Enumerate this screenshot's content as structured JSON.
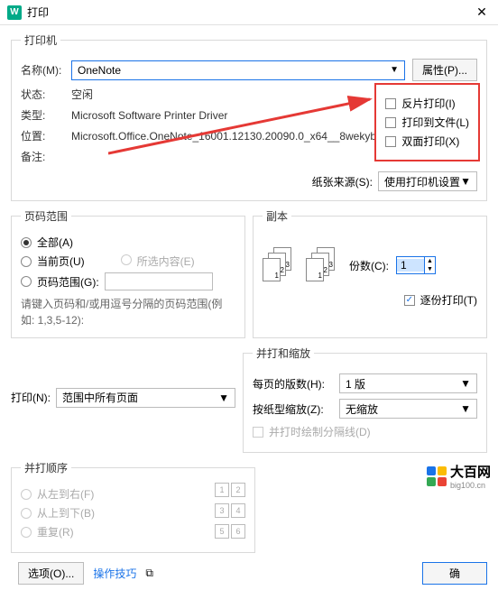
{
  "title": "打印",
  "printer_group": "打印机",
  "name_label": "名称(M):",
  "name_value": "OneNote",
  "properties_btn": "属性(P)...",
  "status_label": "状态:",
  "status_value": "空闲",
  "type_label": "类型:",
  "type_value": "Microsoft Software Printer Driver",
  "where_label": "位置:",
  "where_value": "Microsoft.Office.OneNote_16001.12130.20090.0_x64__8wekyb",
  "comment_label": "备注:",
  "opt_mirror": "反片打印(I)",
  "opt_tofile": "打印到文件(L)",
  "opt_duplex": "双面打印(X)",
  "paper_src_label": "纸张来源(S):",
  "paper_src_value": "使用打印机设置",
  "page_range_group": "页码范围",
  "range_all": "全部(A)",
  "range_current": "当前页(U)",
  "range_selection": "所选内容(E)",
  "range_pages": "页码范围(G):",
  "range_hint": "请键入页码和/或用逗号分隔的页码范围(例如: 1,3,5-12):",
  "print_what_label": "打印(N):",
  "print_what_value": "范围中所有页面",
  "copies_group": "副本",
  "copies_label": "份数(C):",
  "copies_value": "1",
  "collate_label": "逐份打印(T)",
  "zoom_group": "并打和缩放",
  "pages_per_label": "每页的版数(H):",
  "pages_per_value": "1 版",
  "scale_label": "按纸型缩放(Z):",
  "scale_value": "无缩放",
  "draw_border": "并打时绘制分隔线(D)",
  "order_group": "并打顺序",
  "order_lr": "从左到右(F)",
  "order_tb": "从上到下(B)",
  "order_repeat": "重复(R)",
  "options_btn": "选项(O)...",
  "tips_link": "操作技巧",
  "ok_btn": "确",
  "watermark_text": "大百网",
  "watermark_sub": "big100.cn"
}
